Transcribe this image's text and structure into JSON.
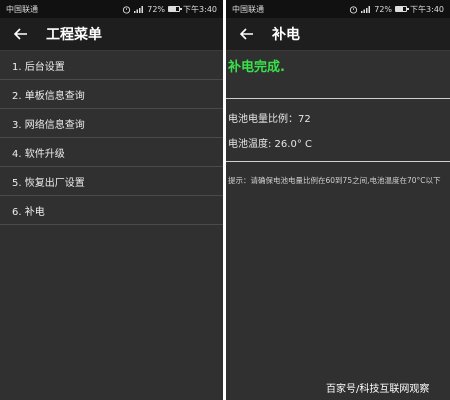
{
  "status_bar": {
    "carrier": "中国联通",
    "battery_text": "72%",
    "battery_level": 0.72,
    "time": "下午3:40",
    "icons": [
      "alarm-icon",
      "signal-icon",
      "battery-icon"
    ]
  },
  "left_screen": {
    "title": "工程菜单",
    "back_icon": "arrow-left-icon",
    "items": [
      {
        "label": "1. 后台设置"
      },
      {
        "label": "2. 单板信息查询"
      },
      {
        "label": "3. 网络信息查询"
      },
      {
        "label": "4. 软件升级"
      },
      {
        "label": "5. 恢复出厂设置"
      },
      {
        "label": "6. 补电"
      }
    ]
  },
  "right_screen": {
    "title": "补电",
    "back_icon": "arrow-left-icon",
    "status_message": "补电完成.",
    "battery_ratio": "电池电量比例：72",
    "battery_temp": "电池温度: 26.0° C",
    "tip": "提示：请确保电池电量比例在60到75之间,电池温度在70°C以下"
  },
  "watermark": "百家号/科技互联网观察",
  "colors": {
    "background": "#303030",
    "status_bar": "#111111",
    "app_bar": "#1e1e1e",
    "success_text": "#39e04a"
  }
}
